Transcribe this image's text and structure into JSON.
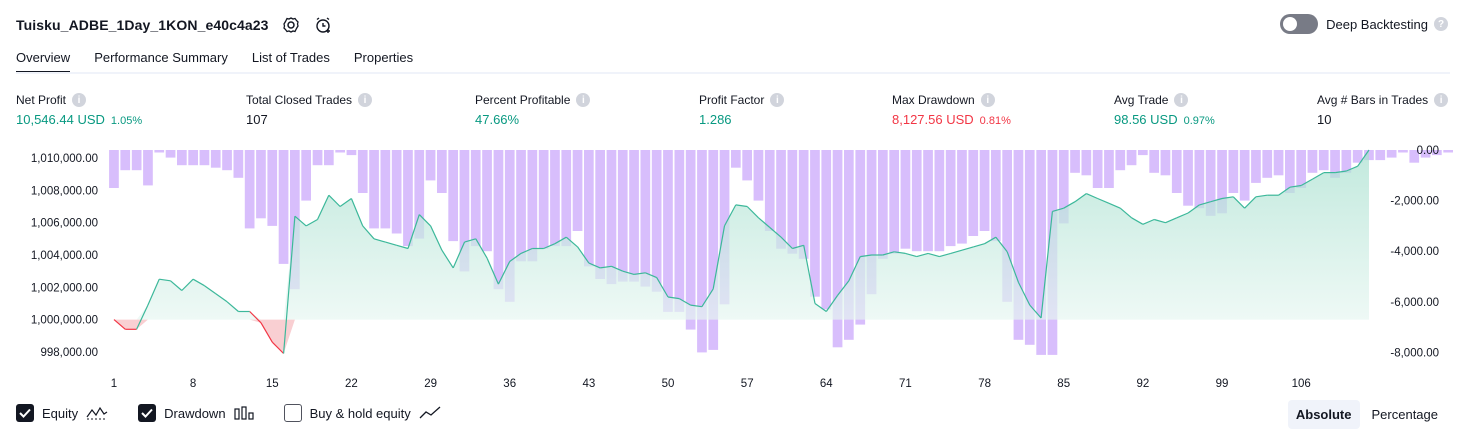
{
  "header": {
    "title": "Tuisku_ADBE_1Day_1KON_e40c4a23",
    "settings_icon": "gear-icon",
    "alert_icon": "alarm-clock-plus-icon"
  },
  "deep_backtesting": {
    "label": "Deep Backtesting",
    "enabled": false,
    "help": "?"
  },
  "tabs": [
    {
      "label": "Overview",
      "active": true
    },
    {
      "label": "Performance Summary",
      "active": false
    },
    {
      "label": "List of Trades",
      "active": false
    },
    {
      "label": "Properties",
      "active": false
    }
  ],
  "metrics": {
    "net_profit": {
      "label": "Net Profit",
      "value": "10,546.44 USD",
      "pct": "1.05%"
    },
    "total_closed_trades": {
      "label": "Total Closed Trades",
      "value": "107"
    },
    "percent_profitable": {
      "label": "Percent Profitable",
      "value": "47.66%"
    },
    "profit_factor": {
      "label": "Profit Factor",
      "value": "1.286"
    },
    "max_drawdown": {
      "label": "Max Drawdown",
      "value": "8,127.56 USD",
      "pct": "0.81%"
    },
    "avg_trade": {
      "label": "Avg Trade",
      "value": "98.56 USD",
      "pct": "0.97%"
    },
    "avg_bars": {
      "label": "Avg # Bars in Trades",
      "value": "10"
    }
  },
  "colors": {
    "green": "#089981",
    "red": "#f23645",
    "drawdown_bar": "#d4b7fc",
    "equity_line": "#3cb89a",
    "equity_fill": "#c9ece1",
    "equity_negative": "#f23645"
  },
  "chart_data": {
    "type": "area",
    "x_ticks": [
      "1",
      "8",
      "15",
      "22",
      "29",
      "36",
      "43",
      "50",
      "57",
      "64",
      "71",
      "78",
      "85",
      "92",
      "99",
      "106"
    ],
    "y_left_ticks": [
      "1,010,000.00",
      "1,008,000.00",
      "1,006,000.00",
      "1,004,000.00",
      "1,002,000.00",
      "1,000,000.00",
      "998,000.00"
    ],
    "y_right_ticks": [
      "0.00",
      "-2,000.00",
      "-4,000.00",
      "-6,000.00",
      "-8,000.00"
    ],
    "y_left_range": [
      997500,
      1010500
    ],
    "y_right_range": [
      -8300,
      0
    ],
    "baseline": 1000000,
    "series": [
      {
        "name": "Equity",
        "type": "line",
        "values": [
          1000000,
          999400,
          999400,
          1000900,
          1002500,
          1002400,
          1001800,
          1002500,
          1002100,
          1001600,
          1001100,
          1000500,
          1000500,
          999800,
          998600,
          997900,
          1006400,
          1005800,
          1006200,
          1007700,
          1007000,
          1007500,
          1005800,
          1005000,
          1004800,
          1004600,
          1004400,
          1006500,
          1005800,
          1004300,
          1003200,
          1004800,
          1005000,
          1003800,
          1002200,
          1003600,
          1004100,
          1004400,
          1004400,
          1004700,
          1005100,
          1004500,
          1003500,
          1003200,
          1003300,
          1003000,
          1002800,
          1002900,
          1002600,
          1001400,
          1001300,
          1000900,
          1000800,
          1001900,
          1005800,
          1007100,
          1007000,
          1006300,
          1005700,
          1005100,
          1004400,
          1004600,
          1001000,
          1000500,
          1001500,
          1002400,
          1003900,
          1004000,
          1004000,
          1004200,
          1004100,
          1003900,
          1004100,
          1003900,
          1004100,
          1004300,
          1004500,
          1004700,
          1005100,
          1004200,
          1002300,
          1000900,
          1000100,
          1006700,
          1006900,
          1007300,
          1007800,
          1007500,
          1007200,
          1006900,
          1006300,
          1005900,
          1006200,
          1006000,
          1006300,
          1006600,
          1007100,
          1007300,
          1007500,
          1007600,
          1006900,
          1007600,
          1007700,
          1007700,
          1008200,
          1008300,
          1008700,
          1009100,
          1009100,
          1009200,
          1009500,
          1010500
        ]
      },
      {
        "name": "Drawdown",
        "type": "bar",
        "values": [
          -1500,
          -800,
          -800,
          -1400,
          -100,
          -300,
          -600,
          -600,
          -600,
          -700,
          -800,
          -1100,
          -3100,
          -2700,
          -3000,
          -4500,
          -5500,
          -2000,
          -600,
          -600,
          -100,
          -200,
          -1700,
          -3100,
          -3100,
          -3300,
          -3800,
          -3500,
          -1200,
          -1700,
          -3600,
          -4800,
          -3800,
          -4000,
          -5500,
          -6000,
          -4400,
          -4400,
          -3900,
          -3800,
          -3800,
          -3200,
          -4600,
          -5100,
          -5300,
          -5200,
          -5200,
          -5400,
          -5600,
          -6400,
          -6400,
          -7100,
          -8000,
          -7900,
          -6100,
          -700,
          -1200,
          -2000,
          -3200,
          -3900,
          -4100,
          -4300,
          -5800,
          -6300,
          -7800,
          -7500,
          -6900,
          -5700,
          -4300,
          -4100,
          -3900,
          -4000,
          -4000,
          -4000,
          -3800,
          -3700,
          -3400,
          -3200,
          -3600,
          -6000,
          -7500,
          -7700,
          -8100,
          -8100,
          -2900,
          -900,
          -1000,
          -1500,
          -1500,
          -800,
          -600,
          -200,
          -900,
          -1000,
          -1700,
          -2200,
          -2300,
          -2600,
          -2500,
          -1700,
          -2000,
          -1300,
          -1100,
          -1000,
          -1700,
          -1500,
          -900,
          -800,
          -1100,
          -900,
          -500,
          -400,
          -400,
          -300,
          -100,
          -500,
          -300,
          -200,
          -100
        ]
      }
    ]
  },
  "legend": {
    "equity": {
      "label": "Equity",
      "checked": true,
      "glyph": "equity-line-icon"
    },
    "drawdown": {
      "label": "Drawdown",
      "checked": true,
      "glyph": "bar-chart-icon"
    },
    "buyhold": {
      "label": "Buy & hold equity",
      "checked": false,
      "glyph": "trend-line-icon"
    }
  },
  "view_mode": {
    "absolute_label": "Absolute",
    "percentage_label": "Percentage",
    "selected": "Absolute"
  }
}
